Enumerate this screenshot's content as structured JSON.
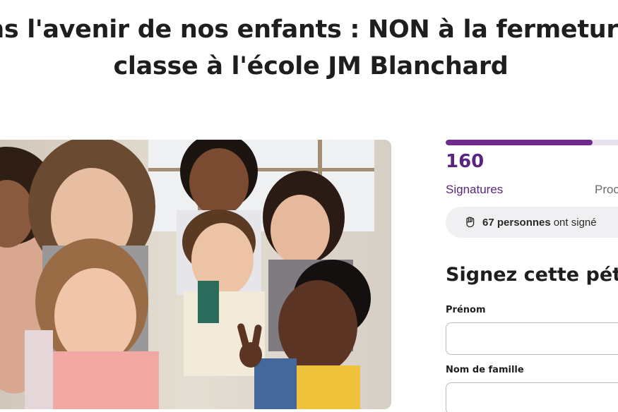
{
  "petition": {
    "title_line1": "ns l'avenir de nos enfants : NON à la fermeture",
    "title_line2": "classe à l'école JM Blanchard"
  },
  "stats": {
    "signature_count": "160",
    "signature_label": "Signatures",
    "goal_label": "Proc",
    "progress_fraction": 0.8,
    "accent_color": "#5a2580"
  },
  "recent": {
    "icon": "hand-icon",
    "bold_text": "67 personnes",
    "text": "ont signé"
  },
  "form": {
    "title": "Signez cette pétit",
    "first_name_label": "Prénom",
    "first_name_value": "",
    "last_name_label": "Nom de famille",
    "last_name_value": ""
  }
}
